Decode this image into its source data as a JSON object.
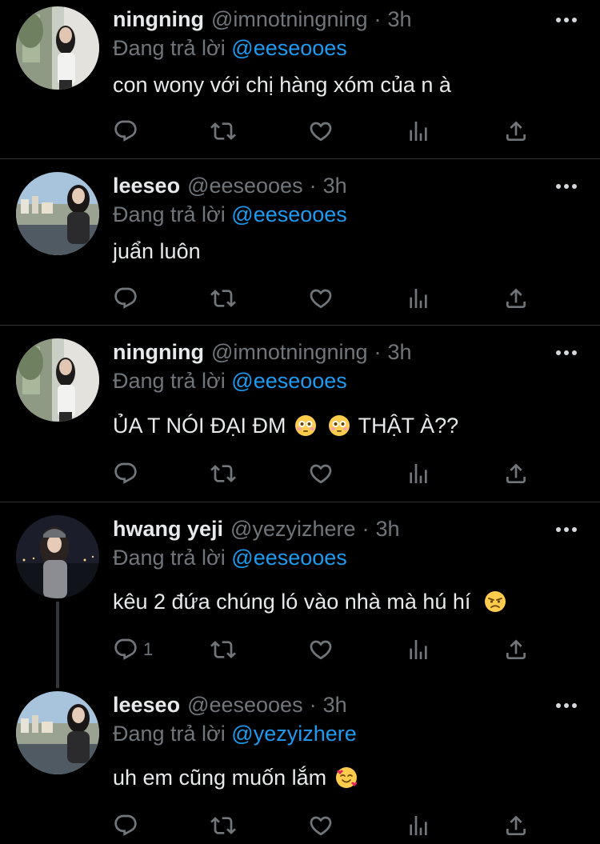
{
  "tweets": [
    {
      "name": "ningning",
      "handle": "@imnotningning",
      "time": "3h",
      "reply_prefix": "Đang trả lời",
      "reply_mention": "@eeseooes",
      "text": "con wony với chị hàng xóm của n à",
      "reply_count": ""
    },
    {
      "name": "leeseo",
      "handle": "@eeseooes",
      "time": "3h",
      "reply_prefix": "Đang trả lời",
      "reply_mention": "@eeseooes",
      "text": "juẩn luôn",
      "reply_count": ""
    },
    {
      "name": "ningning",
      "handle": "@imnotningning",
      "time": "3h",
      "reply_prefix": "Đang trả lời",
      "reply_mention": "@eeseooes",
      "text_before": "ỦA T NÓI ĐẠI ĐM",
      "text_after": "THẬT À??",
      "reply_count": ""
    },
    {
      "name": "hwang yeji",
      "handle": "@yezyizhere",
      "time": "3h",
      "reply_prefix": "Đang trả lời",
      "reply_mention": "@eeseooes",
      "text": "kêu 2 đứa chúng ló vào nhà mà hú hí",
      "reply_count": "1"
    },
    {
      "name": "leeseo",
      "handle": "@eeseooes",
      "time": "3h",
      "reply_prefix": "Đang trả lời",
      "reply_mention": "@yezyizhere",
      "text": "uh em cũng muốn lắm",
      "reply_count": ""
    }
  ],
  "dot_separator": "·",
  "icons": {
    "reply": "reply-icon",
    "retweet": "retweet-icon",
    "like": "heart-icon",
    "views": "analytics-icon",
    "share": "share-icon",
    "more": "more-icon",
    "emoji_flushed": "flushed-face-emoji",
    "emoji_angry": "angry-face-emoji",
    "emoji_love": "smiling-face-with-hearts-emoji"
  },
  "colors": {
    "background": "#000000",
    "text_primary": "#e7e9ea",
    "text_secondary": "#71767b",
    "mention": "#1d9bf0",
    "divider": "#2f3336"
  }
}
